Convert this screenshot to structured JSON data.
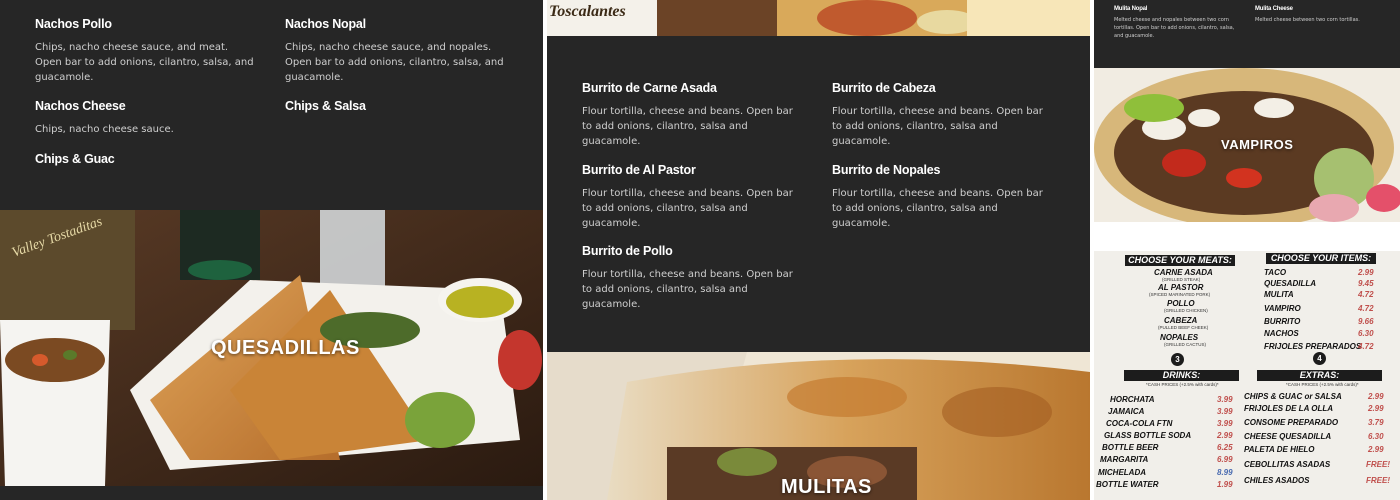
{
  "panel_left": {
    "items": [
      {
        "name": "Nachos Pollo",
        "desc": "Chips, nacho cheese sauce, and meat. Open bar to add onions, cilantro, salsa, and guacamole."
      },
      {
        "name": "Nachos Nopal",
        "desc": "Chips, nacho cheese sauce, and nopales. Open bar to add onions, cilantro, salsa, and guacamole."
      },
      {
        "name": "Nachos Cheese",
        "desc": "Chips, nacho cheese sauce."
      },
      {
        "name": "Chips & Salsa",
        "desc": ""
      },
      {
        "name": "Chips & Guac",
        "desc": ""
      }
    ],
    "photo_label": "QUESADILLAS",
    "cup_text": "Valley Tostaditas"
  },
  "panel_middle": {
    "top_photo_text": "Toscalantes",
    "items": [
      {
        "name": "Burrito de Carne Asada",
        "desc": "Flour tortilla, cheese and beans. Open bar to add onions, cilantro, salsa and guacamole."
      },
      {
        "name": "Burrito de Cabeza",
        "desc": "Flour tortilla, cheese and beans. Open bar to add onions, cilantro, salsa and guacamole."
      },
      {
        "name": "Burrito de Al Pastor",
        "desc": "Flour tortilla, cheese and beans. Open bar to add onions, cilantro, salsa and guacamole."
      },
      {
        "name": "Burrito de Nopales",
        "desc": "Flour tortilla, cheese and beans. Open bar to add onions, cilantro, salsa and guacamole."
      },
      {
        "name": "Burrito de Pollo",
        "desc": "Flour tortilla, cheese and beans. Open bar to add onions, cilantro, salsa and guacamole."
      }
    ],
    "photo_label": "MULITAS"
  },
  "panel_right": {
    "items": [
      {
        "name": "Mulita Nopal",
        "desc": "Melted cheese and nopales between two corn tortillas. Open bar to add onions, cilantro, salsa, and guacamole."
      },
      {
        "name": "Mulita Cheese",
        "desc": "Melted cheese between two corn tortillas."
      }
    ],
    "photo_label": "VAMPIROS",
    "board": {
      "meats_header": "CHOOSE YOUR MEATS:",
      "meats": [
        {
          "name": "CARNE ASADA",
          "sub": "(GRILLED STEAK)"
        },
        {
          "name": "AL PASTOR",
          "sub": "(SPICED MARINATED PORK)"
        },
        {
          "name": "POLLO",
          "sub": "(GRILLED CHICKEN)"
        },
        {
          "name": "CABEZA",
          "sub": "(PULLED BEEF CHEEK)"
        },
        {
          "name": "NOPALES",
          "sub": "(GRILLED CACTUS)"
        }
      ],
      "items_header": "CHOOSE YOUR ITEMS:",
      "items": [
        {
          "name": "TACO",
          "price": "2.99"
        },
        {
          "name": "QUESADILLA",
          "price": "9.45"
        },
        {
          "name": "MULITA",
          "price": "4.72"
        },
        {
          "name": "VAMPIRO",
          "price": "4.72"
        },
        {
          "name": "BURRITO",
          "price": "9.66"
        },
        {
          "name": "NACHOS",
          "price": "6.30"
        },
        {
          "name": "FRIJOLES PREPARADOS",
          "price": "4.72"
        }
      ],
      "step3": "3",
      "step4": "4",
      "drinks_header": "DRINKS:",
      "drinks_note": "*CASH PRICES (+2.5% with cards)*",
      "drinks": [
        {
          "name": "HORCHATA",
          "price": "3.99"
        },
        {
          "name": "JAMAICA",
          "price": "3.99"
        },
        {
          "name": "COCA-COLA FTN",
          "price": "3.99"
        },
        {
          "name": "GLASS BOTTLE SODA",
          "price": "2.99"
        },
        {
          "name": "BOTTLE BEER",
          "price": "6.25"
        },
        {
          "name": "MARGARITA",
          "price": "6.99"
        },
        {
          "name": "MICHELADA",
          "price": "8.99"
        },
        {
          "name": "BOTTLE WATER",
          "price": "1.99"
        }
      ],
      "extras_header": "EXTRAS:",
      "extras_note": "*CASH PRICES (+2.5% with cards)*",
      "extras": [
        {
          "name": "CHIPS & GUAC or SALSA",
          "price": "2.99"
        },
        {
          "name": "FRIJOLES DE LA OLLA",
          "price": "2.99"
        },
        {
          "name": "CONSOME PREPARADO",
          "price": "3.79"
        },
        {
          "name": "CHEESE QUESADILLA",
          "price": "6.30"
        },
        {
          "name": "PALETA DE HIELO",
          "price": "2.99"
        },
        {
          "name": "CEBOLLITAS ASADAS",
          "price": "FREE!"
        },
        {
          "name": "CHILES ASADOS",
          "price": "FREE!"
        }
      ]
    }
  }
}
